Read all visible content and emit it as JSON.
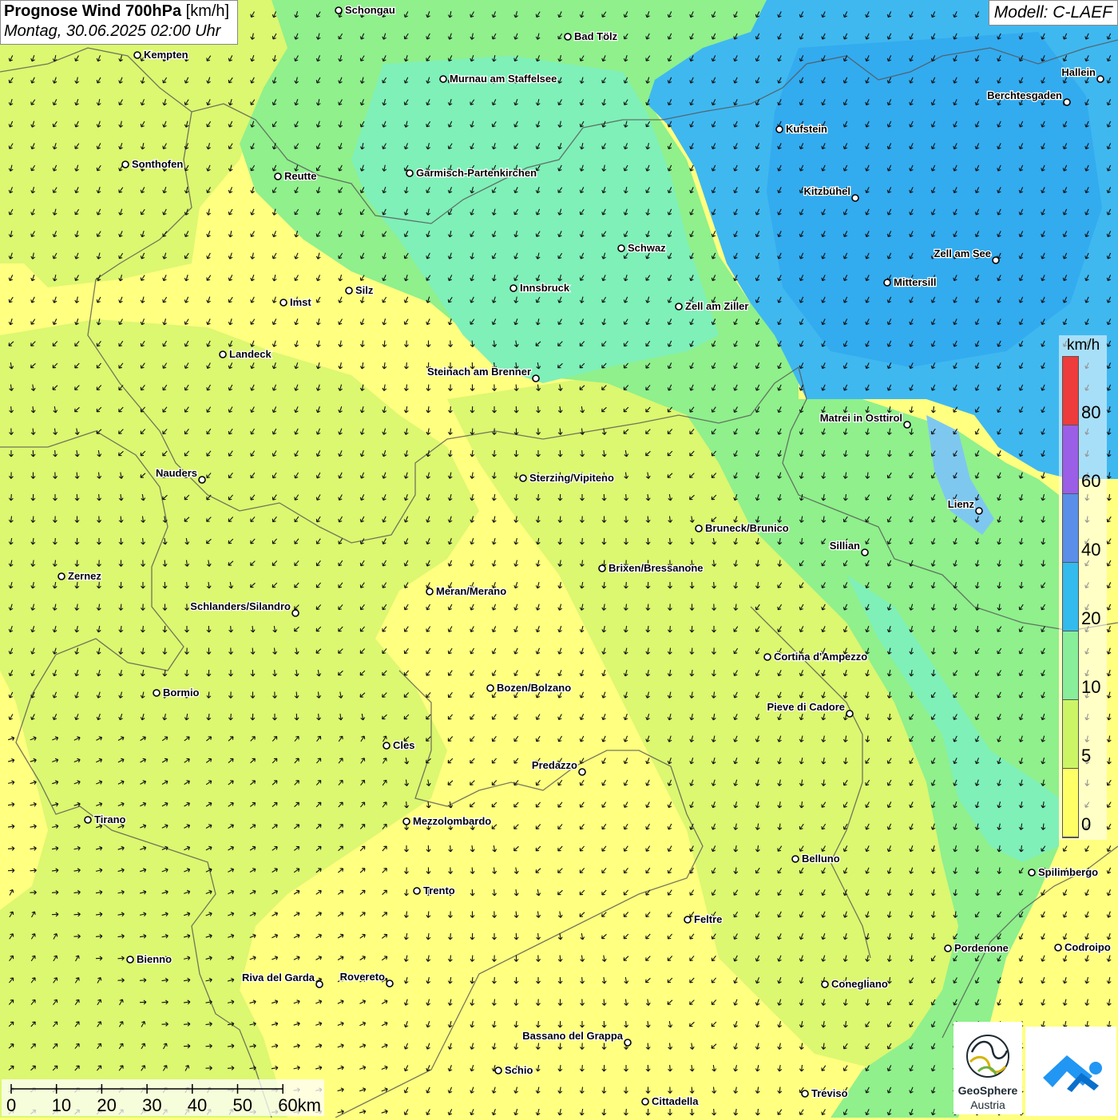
{
  "header": {
    "title_bold": "Prognose Wind 700hPa",
    "title_unit": "[km/h]",
    "datetime": "Montag, 30.06.2025 02:00 Uhr",
    "model": "Modell: C-LAEF"
  },
  "legend": {
    "unit": "km/h",
    "labels": [
      "80",
      "60",
      "40",
      "20",
      "10",
      "5",
      "0"
    ],
    "colors": [
      "#ee3b3b",
      "#9b5ee6",
      "#5b8ee8",
      "#33bbee",
      "#88ee99",
      "#ccf566",
      "#ffff66"
    ]
  },
  "scale_bar": {
    "labels": [
      "0",
      "10",
      "20",
      "30",
      "40",
      "50",
      "60km"
    ]
  },
  "logos": {
    "geosphere_name": "GeoSphere",
    "geosphere_sub": "Austria"
  },
  "map_colors": {
    "calm": "#ffff80",
    "light": "#dcf770",
    "moderate": "#8ff08c",
    "fresh": "#7ff0b8",
    "strong": "#3fb8f0",
    "dark_strong": "#2aa0ee"
  },
  "cities": [
    {
      "name": "Schongau"
    },
    {
      "name": "Bad Tölz"
    },
    {
      "name": "Kempten"
    },
    {
      "name": "Murnau am Staffelsee"
    },
    {
      "name": "Hallein"
    },
    {
      "name": "Berchtesgaden"
    },
    {
      "name": "Kufstein"
    },
    {
      "name": "Sonthofen"
    },
    {
      "name": "Reutte"
    },
    {
      "name": "Garmisch-Partenkirchen"
    },
    {
      "name": "Kitzbühel"
    },
    {
      "name": "Schwaz"
    },
    {
      "name": "Zell am See"
    },
    {
      "name": "Mittersill"
    },
    {
      "name": "Innsbruck"
    },
    {
      "name": "Silz"
    },
    {
      "name": "Imst"
    },
    {
      "name": "Zell am Ziller"
    },
    {
      "name": "Landeck"
    },
    {
      "name": "Steinach am Brenner"
    },
    {
      "name": "Matrei in Osttirol"
    },
    {
      "name": "Nauders"
    },
    {
      "name": "Sterzing/Vipiteno"
    },
    {
      "name": "Lienz"
    },
    {
      "name": "Bruneck/Brunico"
    },
    {
      "name": "Sillian"
    },
    {
      "name": "Brixen/Bressanone"
    },
    {
      "name": "Zernez"
    },
    {
      "name": "Meran/Merano"
    },
    {
      "name": "Schlanders/Silandro"
    },
    {
      "name": "Cortina d'Ampezzo"
    },
    {
      "name": "Bozen/Bolzano"
    },
    {
      "name": "Bormio"
    },
    {
      "name": "Pieve di Cadore"
    },
    {
      "name": "Cles"
    },
    {
      "name": "Predazzo"
    },
    {
      "name": "Tirano"
    },
    {
      "name": "Mezzolombardo"
    },
    {
      "name": "Belluno"
    },
    {
      "name": "Spilimbergo"
    },
    {
      "name": "Trento"
    },
    {
      "name": "Feltre"
    },
    {
      "name": "Pordenone"
    },
    {
      "name": "Codroipo"
    },
    {
      "name": "Bienno"
    },
    {
      "name": "Riva del Garda"
    },
    {
      "name": "Rovereto"
    },
    {
      "name": "Conegliano"
    },
    {
      "name": "Bassano del Grappa"
    },
    {
      "name": "Schio"
    },
    {
      "name": "Treviso"
    },
    {
      "name": "Cittadella"
    }
  ]
}
